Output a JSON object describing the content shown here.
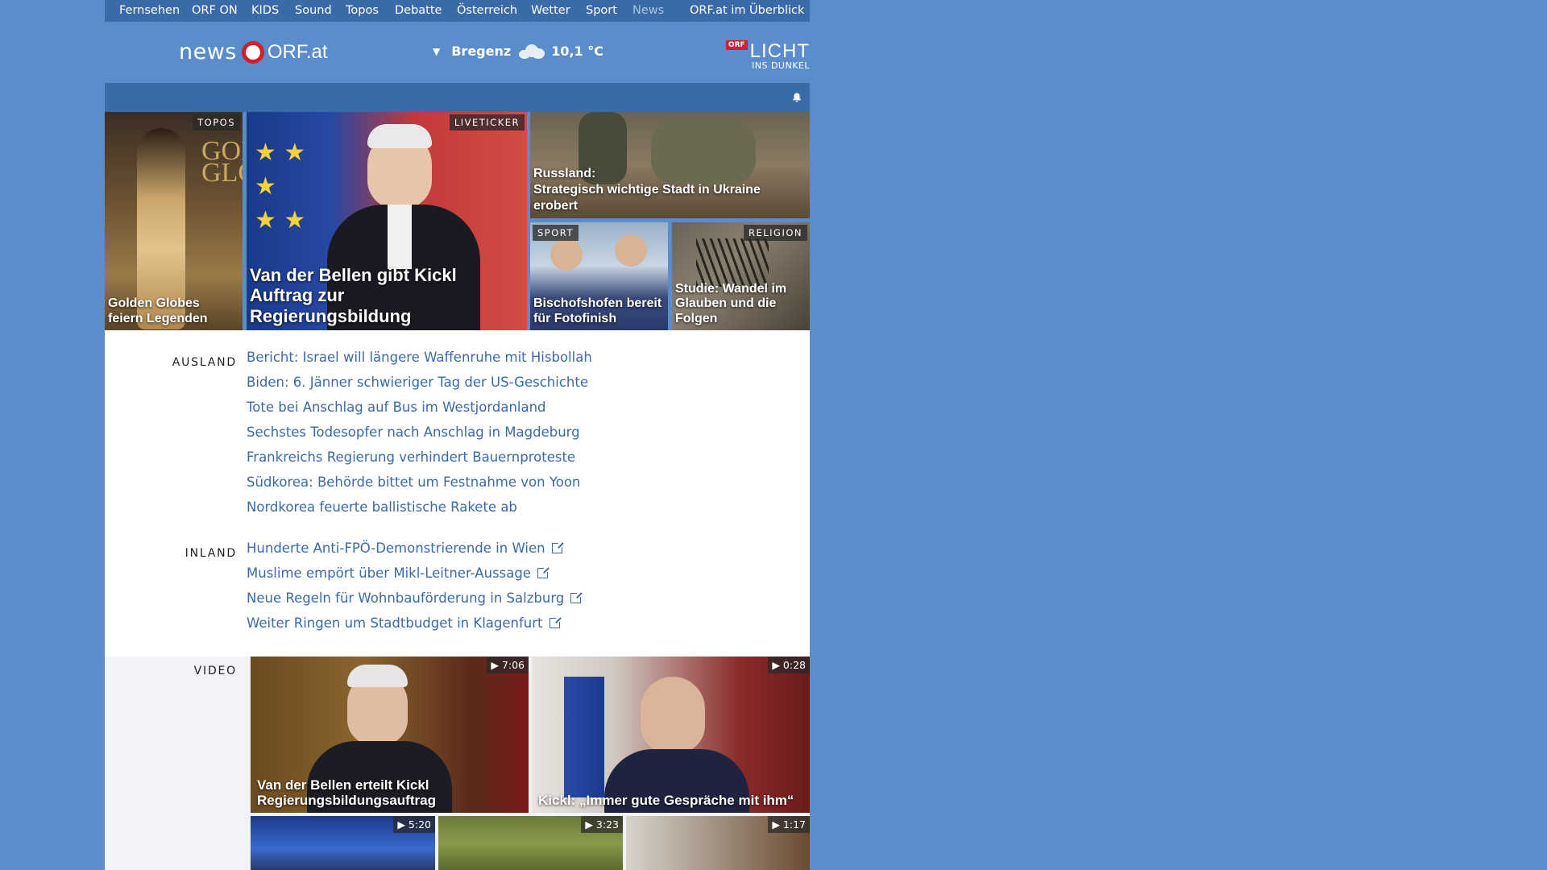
{
  "topnav": {
    "items": [
      "Fernsehen",
      "ORF ON",
      "KIDS",
      "Sound",
      "Topos",
      "Debatte",
      "Österreich",
      "Wetter",
      "Sport",
      "News",
      "ORF.at im Überblick"
    ]
  },
  "header": {
    "logo_news": "news",
    "logo_orf": "ORF.at",
    "weather_city": "Bregenz",
    "weather_temp": "10,1 °C",
    "licht_badge": "ORF",
    "licht_big": "LICHT",
    "licht_small": "INS DUNKEL"
  },
  "hero": {
    "topos": {
      "tag": "TOPOS",
      "caption": "Golden Globes feiern Legenden"
    },
    "main": {
      "tag": "LIVETICKER",
      "caption": "Van der Bellen gibt Kickl Auftrag zur Regierungsbildung"
    },
    "russia": {
      "caption_1": "Russland:",
      "caption_2": "Strategisch wichtige Stadt in Ukraine erobert"
    },
    "sport": {
      "tag": "SPORT",
      "caption": "Bischofshofen bereit für Fotofinish"
    },
    "religion": {
      "tag": "RELIGION",
      "caption": "Studie: Wandel im Glauben und die Folgen"
    }
  },
  "ausland": {
    "label": "AUSLAND",
    "items": [
      "Bericht: Israel will längere Waffenruhe mit Hisbollah",
      "Biden: 6. Jänner schwieriger Tag der US-Geschichte",
      "Tote bei Anschlag auf Bus im Westjordanland",
      "Sechstes Todesopfer nach Anschlag in Magdeburg",
      "Frankreichs Regierung verhindert Bauernproteste",
      "Südkorea: Behörde bittet um Festnahme von Yoon",
      "Nordkorea feuerte ballistische Rakete ab"
    ]
  },
  "inland": {
    "label": "INLAND",
    "items": [
      "Hunderte Anti-FPÖ-Demonstrierende in Wien",
      "Muslime empört über Mikl-Leitner-Aussage",
      "Neue Regeln für Wohnbauförderung in Salzburg",
      "Weiter Ringen um Stadtbudget in Klagenfurt"
    ]
  },
  "video": {
    "label": "VIDEO",
    "items": [
      {
        "duration": "7:06",
        "caption": "Van der Bellen erteilt Kickl Regierungsbildungsauftrag"
      },
      {
        "duration": "0:28",
        "caption": "Kickl: „Immer gute Gespräche mit ihm“"
      },
      {
        "duration": "5:20",
        "caption": ""
      },
      {
        "duration": "3:23",
        "caption": ""
      },
      {
        "duration": "1:17",
        "caption": ""
      }
    ]
  },
  "colors": {
    "brand_blue": "#3a6aa8",
    "bg_blue": "#5b8ccb",
    "orf_red": "#d1202b"
  }
}
